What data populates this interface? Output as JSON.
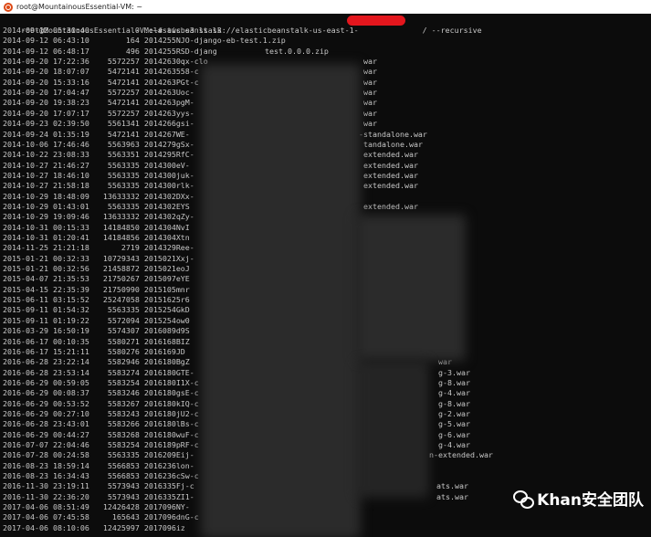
{
  "window": {
    "title": "root@MountainousEssential-VM: ~"
  },
  "terminal": {
    "command_prompt": "root@MountainousEssential-VM:~#",
    "command_text": " aws s3 ls s3://elasticbeanstalk-us-east-1-",
    "command_suffix": "/ --recursive",
    "rows": [
      "2014-09-12 05:30:40          0 .elasticbeanstalk",
      "2014-09-12 06:43:10        164 2014255NJO-django-eb-test.1.zip",
      "2014-09-12 06:48:17        496 2014255RSD-djang",
      "2014-09-20 17:22:36    5572257 20142630qx-clo",
      "2014-09-20 18:07:07    5472141 2014263558-c",
      "2014-09-20 15:33:16    5472141 2014263PGt-c",
      "2014-09-20 17:04:47    5572257 2014263Uoc-",
      "2014-09-20 19:38:23    5472141 2014263pgM-",
      "2014-09-20 17:07:17    5572257 2014263yys-",
      "2014-09-23 02:39:50    5561341 2014266gsi-",
      "2014-09-24 01:35:19    5472141 2014267WE-",
      "2014-10-06 17:46:46    5563963 2014279gSx-",
      "2014-10-22 23:08:33    5563351 2014295RfC-",
      "2014-10-27 21:46:27    5563335 2014300eV-",
      "2014-10-27 18:46:10    5563335 2014300juk-",
      "2014-10-27 21:58:18    5563335 2014300rlk-",
      "2014-10-29 18:48:09   13633332 2014302DXx-",
      "2014-10-29 01:43:01    5563335 2014302EYS",
      "2014-10-29 19:09:46   13633332 2014302qZy-",
      "2014-10-31 00:15:33   14184850 2014304NvI",
      "2014-10-31 01:20:41   14184856 2014304Xtn",
      "2014-11-25 21:21:18       2719 2014329Ree-",
      "2015-01-21 00:32:33   10729343 2015021Xxj-",
      "2015-01-21 00:32:56   21458872 2015021eoJ",
      "2015-04-07 21:35:53   21750267 2015097eYE",
      "2015-04-15 22:35:39   21750990 2015105mnr",
      "2015-06-11 03:15:52   25247058 20151625r6",
      "2015-09-11 01:54:32    5563335 2015254GkD",
      "2015-09-11 01:19:22    5572094 2015254ow0",
      "2016-03-29 16:50:19    5574307 2016089d9S",
      "2016-06-17 00:10:35    5580271 2016168BIZ",
      "2016-06-17 15:21:11    5580276 2016169JD",
      "2016-06-28 23:22:14    5582946 2016180BgZ",
      "2016-06-28 23:53:14    5583274 2016180GTE-",
      "2016-06-29 00:59:05    5583254 2016180I1X-c",
      "2016-06-29 00:08:37    5583246 2016180gsE-c",
      "2016-06-29 00:53:52    5583267 2016180kIQ-c",
      "2016-06-29 00:27:10    5583243 2016180jU2-c",
      "2016-06-28 23:43:01    5583266 2016180lBs-c",
      "2016-06-29 00:44:27    5583268 2016180wuF-c",
      "2016-07-07 22:04:46    5583254 2016189pRF-c",
      "2016-07-28 00:24:58    5563335 2016209Eij-",
      "2016-08-23 18:59:14    5566853 2016236lon-",
      "2016-08-23 16:34:43    5566853 2016236cSw-c",
      "2016-11-30 23:19:11    5573943 2016335Fj-c",
      "2016-11-30 22:36:20    5573943 2016335ZI1-",
      "2017-04-06 08:51:49   12426428 2017096NY-",
      "2017-04-06 07:45:58     165643 2017096dnG-c",
      "2017-04-06 08:10:06   12425997 2017096iz"
    ],
    "right_fragments": [
      {
        "row": 2,
        "text": "test.0.0.0.zip"
      },
      {
        "row": 3,
        "text": "war"
      },
      {
        "row": 4,
        "text": "war"
      },
      {
        "row": 5,
        "text": "war"
      },
      {
        "row": 6,
        "text": "war"
      },
      {
        "row": 7,
        "text": "war"
      },
      {
        "row": 8,
        "text": "war"
      },
      {
        "row": 9,
        "text": "war"
      },
      {
        "row": 10,
        "text": "-standalone.war"
      },
      {
        "row": 11,
        "text": "tandalone.war"
      },
      {
        "row": 12,
        "text": "extended.war"
      },
      {
        "row": 13,
        "text": "extended.war"
      },
      {
        "row": 14,
        "text": "extended.war"
      },
      {
        "row": 15,
        "text": "extended.war"
      },
      {
        "row": 17,
        "text": "extended.war"
      },
      {
        "row": 32,
        "text": "war"
      },
      {
        "row": 33,
        "text": "g-3.war"
      },
      {
        "row": 34,
        "text": "g-8.war"
      },
      {
        "row": 35,
        "text": "g-4.war"
      },
      {
        "row": 36,
        "text": "g-8.war"
      },
      {
        "row": 37,
        "text": "g-2.war"
      },
      {
        "row": 38,
        "text": "g-5.war"
      },
      {
        "row": 39,
        "text": "g-6.war"
      },
      {
        "row": 40,
        "text": "g-4.war"
      },
      {
        "row": 41,
        "text": "n-extended.war"
      },
      {
        "row": 44,
        "text": "ats.war"
      },
      {
        "row": 45,
        "text": "ats.war"
      }
    ]
  },
  "watermark": {
    "icon": "wechat-icon",
    "text": "Khan安全团队"
  }
}
